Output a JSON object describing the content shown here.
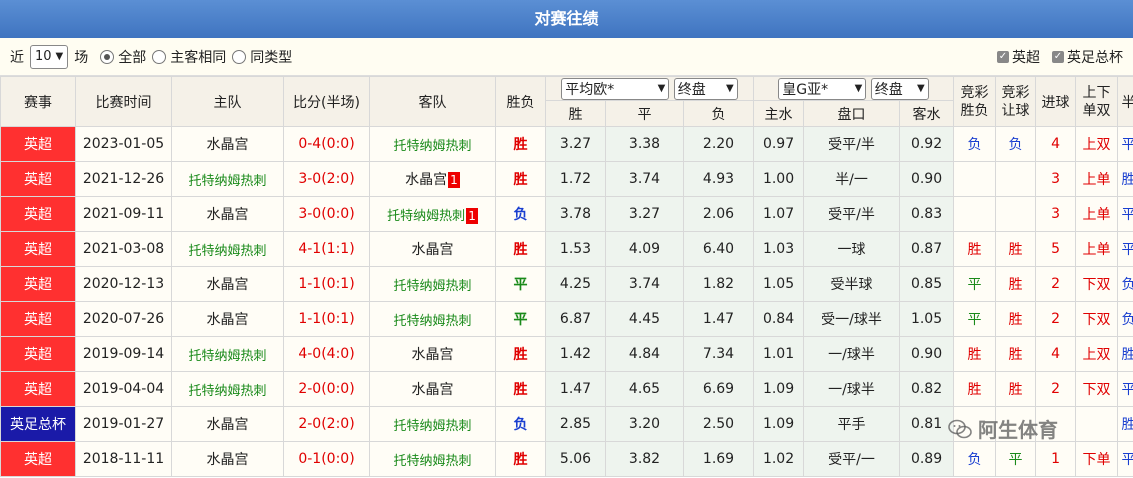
{
  "title": "对赛往绩",
  "filter": {
    "near_label": "近",
    "count_value": "10",
    "count_unit": "场",
    "radio_all": "全部",
    "radio_same_home": "主客相同",
    "radio_same_type": "同类型",
    "check_premier": "英超",
    "check_fa_cup": "英足总杯"
  },
  "headers": {
    "league": "赛事",
    "date": "比赛时间",
    "home": "主队",
    "score": "比分(半场)",
    "away": "客队",
    "result": "胜负",
    "eu_select": "平均欧*",
    "eu_select2": "终盘",
    "ah_select": "皇G亚*",
    "ah_select2": "终盘",
    "lottery_wdl": "竞彩胜负",
    "lottery_hcp": "竞彩让球",
    "goals": "进球",
    "ou_single_double": "上下单双",
    "half_full": "半全",
    "sub_win": "胜",
    "sub_draw": "平",
    "sub_lose": "负",
    "sub_home_water": "主水",
    "sub_handicap": "盘口",
    "sub_away_water": "客水"
  },
  "colors": {
    "premier": "#ff3030",
    "fa_cup": "#1a1aa8",
    "red": "#e00000",
    "green": "#1a8a1a",
    "blue": "#1a3fd0"
  },
  "rows": [
    {
      "league": "英超",
      "league_color": "#ff3030",
      "date": "2023-01-05",
      "home": "水晶宫",
      "home_color": "dark",
      "home_badge": "",
      "score": "0-4(0:0)",
      "score_color": "red",
      "away": "托特纳姆热刺",
      "away_color": "green",
      "away_badge": "",
      "result": "胜",
      "result_color": "red",
      "w": "3.27",
      "d": "3.38",
      "l": "2.20",
      "hw": "0.97",
      "hcp": "受平/半",
      "aw": "0.92",
      "lw": "负",
      "lw_color": "blue",
      "lh": "负",
      "lh_color": "blue",
      "goals": "4",
      "ou": "上双",
      "ou_color": "red",
      "hf": "平负",
      "hf_color": "blue"
    },
    {
      "league": "英超",
      "league_color": "#ff3030",
      "date": "2021-12-26",
      "home": "托特纳姆热刺",
      "home_color": "green",
      "home_badge": "",
      "score": "3-0(2:0)",
      "score_color": "red",
      "away": "水晶宫",
      "away_color": "dark",
      "away_badge": "1",
      "result": "胜",
      "result_color": "red",
      "w": "1.72",
      "d": "3.74",
      "l": "4.93",
      "hw": "1.00",
      "hcp": "半/一",
      "aw": "0.90",
      "lw": "",
      "lw_color": "blue",
      "lh": "",
      "lh_color": "blue",
      "goals": "3",
      "ou": "上单",
      "ou_color": "red",
      "hf": "胜胜",
      "hf_color": "blue"
    },
    {
      "league": "英超",
      "league_color": "#ff3030",
      "date": "2021-09-11",
      "home": "水晶宫",
      "home_color": "dark",
      "home_badge": "",
      "score": "3-0(0:0)",
      "score_color": "red",
      "away": "托特纳姆热刺",
      "away_color": "green",
      "away_badge": "1",
      "result": "负",
      "result_color": "blue",
      "w": "3.78",
      "d": "3.27",
      "l": "2.06",
      "hw": "1.07",
      "hcp": "受平/半",
      "aw": "0.83",
      "lw": "",
      "lw_color": "blue",
      "lh": "",
      "lh_color": "blue",
      "goals": "3",
      "ou": "上单",
      "ou_color": "red",
      "hf": "平胜",
      "hf_color": "blue"
    },
    {
      "league": "英超",
      "league_color": "#ff3030",
      "date": "2021-03-08",
      "home": "托特纳姆热刺",
      "home_color": "green",
      "home_badge": "",
      "score": "4-1(1:1)",
      "score_color": "red",
      "away": "水晶宫",
      "away_color": "dark",
      "away_badge": "",
      "result": "胜",
      "result_color": "red",
      "w": "1.53",
      "d": "4.09",
      "l": "6.40",
      "hw": "1.03",
      "hcp": "一球",
      "aw": "0.87",
      "lw": "胜",
      "lw_color": "red",
      "lh": "胜",
      "lh_color": "red",
      "goals": "5",
      "ou": "上单",
      "ou_color": "red",
      "hf": "平胜",
      "hf_color": "blue"
    },
    {
      "league": "英超",
      "league_color": "#ff3030",
      "date": "2020-12-13",
      "home": "水晶宫",
      "home_color": "dark",
      "home_badge": "",
      "score": "1-1(0:1)",
      "score_color": "red",
      "away": "托特纳姆热刺",
      "away_color": "green",
      "away_badge": "",
      "result": "平",
      "result_color": "green",
      "w": "4.25",
      "d": "3.74",
      "l": "1.82",
      "hw": "1.05",
      "hcp": "受半球",
      "aw": "0.85",
      "lw": "平",
      "lw_color": "green",
      "lh": "胜",
      "lh_color": "red",
      "goals": "2",
      "ou": "下双",
      "ou_color": "red",
      "hf": "负平",
      "hf_color": "blue"
    },
    {
      "league": "英超",
      "league_color": "#ff3030",
      "date": "2020-07-26",
      "home": "水晶宫",
      "home_color": "dark",
      "home_badge": "",
      "score": "1-1(0:1)",
      "score_color": "red",
      "away": "托特纳姆热刺",
      "away_color": "green",
      "away_badge": "",
      "result": "平",
      "result_color": "green",
      "w": "6.87",
      "d": "4.45",
      "l": "1.47",
      "hw": "0.84",
      "hcp": "受一/球半",
      "aw": "1.05",
      "lw": "平",
      "lw_color": "green",
      "lh": "胜",
      "lh_color": "red",
      "goals": "2",
      "ou": "下双",
      "ou_color": "red",
      "hf": "负平",
      "hf_color": "blue"
    },
    {
      "league": "英超",
      "league_color": "#ff3030",
      "date": "2019-09-14",
      "home": "托特纳姆热刺",
      "home_color": "green",
      "home_badge": "",
      "score": "4-0(4:0)",
      "score_color": "red",
      "away": "水晶宫",
      "away_color": "dark",
      "away_badge": "",
      "result": "胜",
      "result_color": "red",
      "w": "1.42",
      "d": "4.84",
      "l": "7.34",
      "hw": "1.01",
      "hcp": "一/球半",
      "aw": "0.90",
      "lw": "胜",
      "lw_color": "red",
      "lh": "胜",
      "lh_color": "red",
      "goals": "4",
      "ou": "上双",
      "ou_color": "red",
      "hf": "胜胜",
      "hf_color": "blue"
    },
    {
      "league": "英超",
      "league_color": "#ff3030",
      "date": "2019-04-04",
      "home": "托特纳姆热刺",
      "home_color": "green",
      "home_badge": "",
      "score": "2-0(0:0)",
      "score_color": "red",
      "away": "水晶宫",
      "away_color": "dark",
      "away_badge": "",
      "result": "胜",
      "result_color": "red",
      "w": "1.47",
      "d": "4.65",
      "l": "6.69",
      "hw": "1.09",
      "hcp": "一/球半",
      "aw": "0.82",
      "lw": "胜",
      "lw_color": "red",
      "lh": "胜",
      "lh_color": "red",
      "goals": "2",
      "ou": "下双",
      "ou_color": "red",
      "hf": "平胜",
      "hf_color": "blue"
    },
    {
      "league": "英足总杯",
      "league_color": "#1a1aa8",
      "date": "2019-01-27",
      "home": "水晶宫",
      "home_color": "dark",
      "home_badge": "",
      "score": "2-0(2:0)",
      "score_color": "red",
      "away": "托特纳姆热刺",
      "away_color": "green",
      "away_badge": "",
      "result": "负",
      "result_color": "blue",
      "w": "2.85",
      "d": "3.20",
      "l": "2.50",
      "hw": "1.09",
      "hcp": "平手",
      "aw": "0.81",
      "lw": "",
      "lw_color": "blue",
      "lh": "",
      "lh_color": "blue",
      "goals": "",
      "ou": "",
      "ou_color": "red",
      "hf": "胜胜",
      "hf_color": "blue"
    },
    {
      "league": "英超",
      "league_color": "#ff3030",
      "date": "2018-11-11",
      "home": "水晶宫",
      "home_color": "dark",
      "home_badge": "",
      "score": "0-1(0:0)",
      "score_color": "red",
      "away": "托特纳姆热刺",
      "away_color": "green",
      "away_badge": "",
      "result": "胜",
      "result_color": "red",
      "w": "5.06",
      "d": "3.82",
      "l": "1.69",
      "hw": "1.02",
      "hcp": "受平/一",
      "aw": "0.89",
      "lw": "负",
      "lw_color": "blue",
      "lh": "平",
      "lh_color": "green",
      "goals": "1",
      "ou": "下单",
      "ou_color": "red",
      "hf": "平负",
      "hf_color": "blue"
    }
  ],
  "watermark": "阿生体育"
}
